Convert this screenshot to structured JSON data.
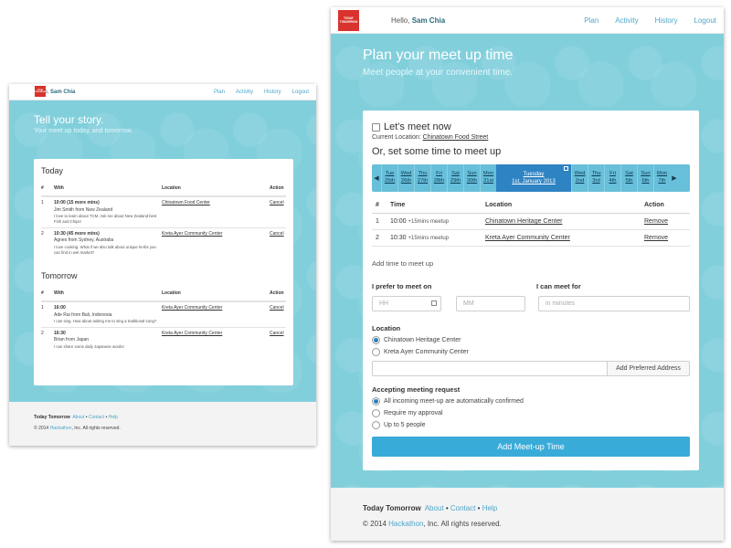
{
  "left": {
    "logo_text": "TODAY TOMORROW",
    "greeting_prefix": "Hello, ",
    "user_name": "Sam Chia",
    "nav": [
      "Plan",
      "Activity",
      "History",
      "Logout"
    ],
    "hero_title": "Tell your story.",
    "hero_subtitle": "Your meet up today, and tomorrow.",
    "columns": [
      "#",
      "With",
      "Location",
      "Action"
    ],
    "sections": [
      {
        "title": "Today",
        "rows": [
          {
            "num": "1",
            "time": "10:00 (15 more mins)",
            "who": "Jim Smith from New Zealand",
            "note": "I love to learn about TCM. Ask me about New Zealand best Fish and Chips!",
            "location": "Chinatown Food Center",
            "action": "Cancel"
          },
          {
            "num": "2",
            "time": "10:30 (45 more mins)",
            "who": "Agnes from Sydney, Australia",
            "note": "I love cooking. What if we also talk about unique herbs you can find in wet market?",
            "location": "Kreta Ayer Community Center",
            "action": "Cancel"
          }
        ]
      },
      {
        "title": "Tomorrow",
        "rows": [
          {
            "num": "1",
            "time": "16:00",
            "who": "Ade Rai from Bali, Indonesia",
            "note": "I can sing. How about asking me to sing a traditional song?",
            "location": "Kreta Ayer Community Center",
            "action": "Cancel"
          },
          {
            "num": "2",
            "time": "16:30",
            "who": "Brian from Japan",
            "note": "I can share some daily Japanese words!",
            "location": "Kreta Ayer Community Center",
            "action": "Cancel"
          }
        ]
      }
    ],
    "footer": {
      "brand": "Today Tomorrow",
      "links": [
        "About",
        "Contact",
        "Help"
      ],
      "copyright_prefix": "© 2014 ",
      "copyright_link": "Hackathon",
      "copyright_suffix": ", Inc. All rights reserved."
    }
  },
  "right": {
    "logo_text": "TODAY TOMORROW",
    "greeting_prefix": "Hello, ",
    "user_name": "Sam Chia",
    "nav": [
      "Plan",
      "Activity",
      "History",
      "Logout"
    ],
    "hero_title": "Plan your meet up time",
    "hero_subtitle": "Meet people at your convenient time.",
    "meet_now_label": "Let's meet now",
    "current_location_label": "Current Location: ",
    "current_location_value": "Chinatown Food Street",
    "set_time_title": "Or, set some time to meet up",
    "calendar": {
      "before": [
        {
          "dow": "Tue",
          "date": "25th"
        },
        {
          "dow": "Wed",
          "date": "26th"
        },
        {
          "dow": "Thu",
          "date": "27th"
        },
        {
          "dow": "Fri",
          "date": "28th"
        },
        {
          "dow": "Sat",
          "date": "29th"
        },
        {
          "dow": "Sun",
          "date": "30th"
        },
        {
          "dow": "Mon",
          "date": "31st"
        }
      ],
      "selected": {
        "dow": "Tuesday",
        "date": "1st, January 2013"
      },
      "after": [
        {
          "dow": "Wed",
          "date": "2nd"
        },
        {
          "dow": "Thu",
          "date": "3rd"
        },
        {
          "dow": "Fri",
          "date": "4th"
        },
        {
          "dow": "Sat",
          "date": "5th"
        },
        {
          "dow": "Sun",
          "date": "6th"
        },
        {
          "dow": "Mon",
          "date": "7th"
        }
      ]
    },
    "columns": [
      "#",
      "Time",
      "Location",
      "Action"
    ],
    "rows": [
      {
        "num": "1",
        "time": "10:00",
        "meetup": "+15mins meetup",
        "location": "Chinatown Heritage Center",
        "action": "Remove"
      },
      {
        "num": "2",
        "time": "10:30",
        "meetup": "+15mins meetup",
        "location": "Kreta Ayer Community Center",
        "action": "Remove"
      }
    ],
    "add_time_label": "Add time to meet up",
    "prefer_label": "I prefer to meet on",
    "can_meet_label": "I can meet for",
    "hh_placeholder": "HH",
    "mm_placeholder": "MM",
    "minutes_placeholder": "in minutes",
    "location_label": "Location",
    "location_options": [
      "Chinatown Heritage Center",
      "Kreta Ayer Community Center"
    ],
    "add_address_label": "Add Preferred Address",
    "accepting_label": "Accepting meeting request",
    "accept_options": [
      "All incoming meet-up are automatically confirmed",
      "Require my approval",
      "Up to 5 people"
    ],
    "submit_label": "Add Meet-up Time",
    "footer": {
      "brand": "Today Tomorrow",
      "links": [
        "About",
        "Contact",
        "Help"
      ],
      "copyright_prefix": "© 2014 ",
      "copyright_link": "Hackathon",
      "copyright_suffix": ", Inc. All rights reserved."
    }
  }
}
